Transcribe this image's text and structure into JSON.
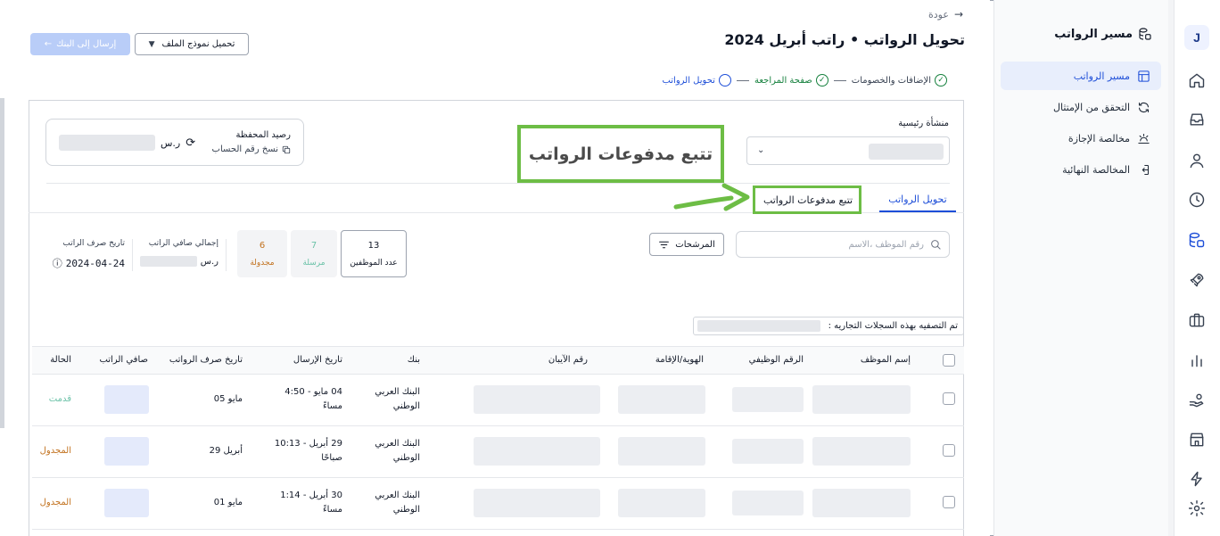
{
  "rail": {
    "logo": "J",
    "icons": [
      "home-icon",
      "inbox-icon",
      "user-icon",
      "clock-icon",
      "payroll-icon",
      "rocket-icon",
      "briefcase-icon",
      "chart-icon",
      "hand-coin-icon",
      "store-icon",
      "bolt-icon",
      "gear-icon"
    ]
  },
  "sidebar": {
    "title": "مسير الرواتب",
    "items": [
      {
        "label": "مسير الرواتب",
        "icon": "table-icon",
        "active": true
      },
      {
        "label": "التحقق من الإمتثال",
        "icon": "refresh-icon",
        "active": false
      },
      {
        "label": "مخالصة الإجازة",
        "icon": "beach-icon",
        "active": false
      },
      {
        "label": "المخالصة النهائية",
        "icon": "exit-icon",
        "active": false
      }
    ]
  },
  "header": {
    "back": "عودة",
    "title": "تحويل الرواتب • راتب أبريل 2024",
    "download_btn": "تحميل نموذج الملف",
    "send_btn": "إرسال إلى البنك"
  },
  "steps": [
    {
      "label": "الإضافات والخصومات",
      "state": "done"
    },
    {
      "label": "صفحة المراجعة",
      "state": "done"
    },
    {
      "label": "تحويل الرواتب",
      "state": "current"
    }
  ],
  "entity": {
    "label": "منشأة رئيسية"
  },
  "wallet": {
    "label": "رصيد المحفظة",
    "copy": "نسخ رقم الحساب",
    "currency": "ر.س"
  },
  "tabs": {
    "tab1": "تحويل الرواتب",
    "tab2": "تتبع مدفوعات الرواتب"
  },
  "callout": {
    "text": "تتبع مدفوعات الرواتب",
    "color": "#6dbd45"
  },
  "search": {
    "placeholder": "رقم الموظف ،الاسم"
  },
  "filters": {
    "label": "المرشحات"
  },
  "stats": {
    "employees": {
      "count": "13",
      "label": "عدد الموظفين"
    },
    "sent": {
      "count": "7",
      "label": "مرسلة"
    },
    "scheduled": {
      "count": "6",
      "label": "مجدولة"
    }
  },
  "summary": {
    "net_label": "إجمالي صافي الراتب",
    "net_currency": "ر.س",
    "date_label": "تاريخ صرف الراتب",
    "date_value": "2024-04-24"
  },
  "cr_note": {
    "label": "تم التصفيه بهذه السجلات التجاريه :"
  },
  "table": {
    "headers": {
      "name": "إسم الموظف",
      "emp_no": "الرقم الوظيفي",
      "id": "الهوية/الإقامة",
      "iban": "رقم الآيبان",
      "bank": "بنك",
      "send_date": "تاريخ الإرسال",
      "pay_date": "تاريخ صرف الرواتب",
      "net": "صافي الراتب",
      "status": "الحالة"
    },
    "rows": [
      {
        "bank1": "البنك العربي",
        "bank2": "الوطني",
        "send1": "04 مايو - 4:50",
        "send2": "مساءً",
        "pay": "مايو 05",
        "status": "قدمت",
        "status_color": "#6bc2a8"
      },
      {
        "bank1": "البنك العربي",
        "bank2": "الوطني",
        "send1": "29 أبريل - 10:13",
        "send2": "صباحًا",
        "pay": "أبريل 29",
        "status": "المجدول",
        "status_color": "#c2721f"
      },
      {
        "bank1": "البنك العربي",
        "bank2": "الوطني",
        "send1": "30 أبريل - 1:14",
        "send2": "مساءً",
        "pay": "مايو 01",
        "status": "المجدول",
        "status_color": "#c2721f"
      }
    ]
  },
  "colors": {
    "accent": "#1d4ed8",
    "success": "#15803d",
    "sent": "#6bc2a8",
    "scheduled": "#c2721f"
  }
}
